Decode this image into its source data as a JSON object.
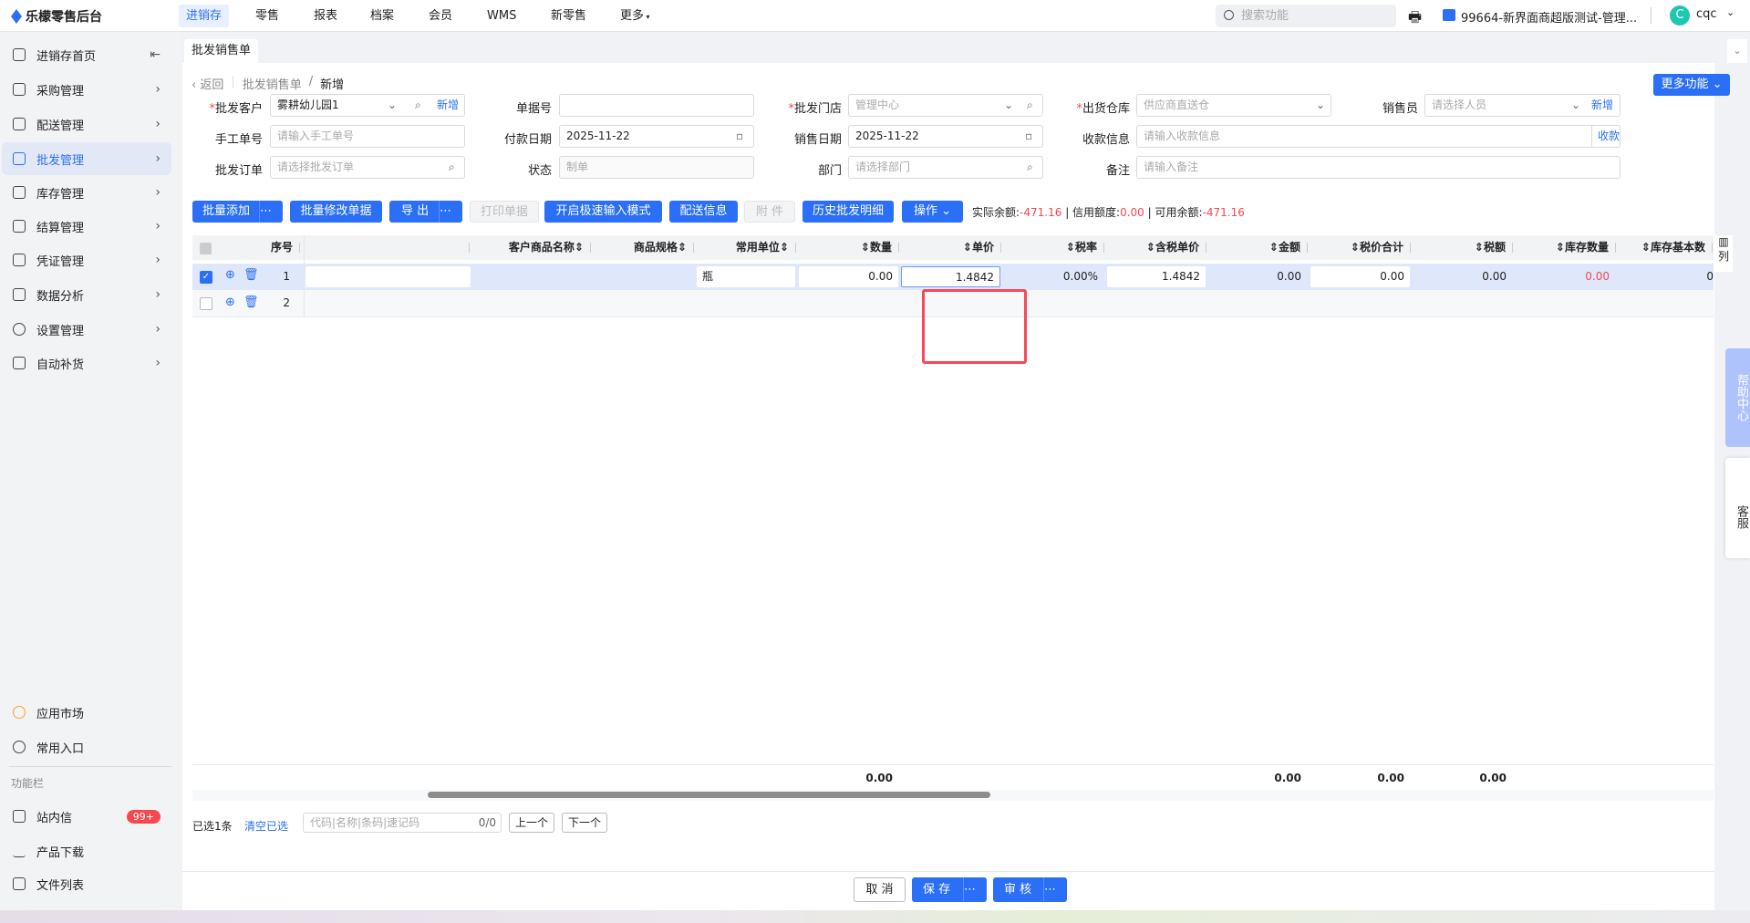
{
  "app": {
    "title": "乐檬零售后台"
  },
  "topnav": [
    "进销存",
    "零售",
    "报表",
    "档案",
    "会员",
    "WMS",
    "新零售",
    "更多"
  ],
  "search": {
    "placeholder": "搜索功能"
  },
  "org": "99664-新界面商超版测试-管理...",
  "user": {
    "avatar": "C",
    "name": "cqc"
  },
  "sidebar": {
    "items": [
      "进销存首页",
      "采购管理",
      "配送管理",
      "批发管理",
      "库存管理",
      "结算管理",
      "凭证管理",
      "数据分析",
      "设置管理",
      "自动补货"
    ],
    "bottom": [
      "应用市场",
      "常用入口"
    ],
    "section": "功能栏",
    "tools": [
      "站内信",
      "产品下载",
      "文件列表"
    ],
    "badge": "99+"
  },
  "tab": "批发销售单",
  "breadcrumb": {
    "back": "返回",
    "parent": "批发销售单",
    "current": "新增"
  },
  "more_button": "更多功能",
  "form": {
    "customer_label": "批发客户",
    "customer_value": "雾耕幼儿园1",
    "add": "新增",
    "doc_no_label": "单据号",
    "store_label": "批发门店",
    "store_value": "管理中心",
    "warehouse_label": "出货仓库",
    "warehouse_value": "供应商直送仓",
    "sales_label": "销售员",
    "sales_placeholder": "请选择人员",
    "manual_label": "手工单号",
    "manual_placeholder": "请输入手工单号",
    "paydate_label": "付款日期",
    "paydate_value": "2025-11-22",
    "saledate_label": "销售日期",
    "saledate_value": "2025-11-22",
    "receipt_label": "收款信息",
    "receipt_placeholder": "请输入收款信息",
    "receipt_link": "收款",
    "order_label": "批发订单",
    "order_placeholder": "请选择批发订单",
    "status_label": "状态",
    "status_value": "制单",
    "dept_label": "部门",
    "dept_placeholder": "请选择部门",
    "remark_label": "备注",
    "remark_placeholder": "请输入备注"
  },
  "toolbar": {
    "batch_add": "批量添加",
    "batch_edit": "批量修改单据",
    "export": "导 出",
    "print": "打印单据",
    "fast_mode": "开启极速输入模式",
    "delivery": "配送信息",
    "attach": "附 件",
    "history": "历史批发明细",
    "ops": "操作",
    "balance_label": "实际余额:",
    "balance": "-471.16",
    "credit_label": "信用额度:",
    "credit": "0.00",
    "avail_label": "可用余额:",
    "avail": "-471.16"
  },
  "table": {
    "columns": [
      "序号",
      "",
      "客户商品名称",
      "商品规格",
      "常用单位",
      "数量",
      "单价",
      "税率",
      "含税单价",
      "金额",
      "税价合计",
      "税额",
      "库存数量",
      "库存基本数"
    ],
    "column_setting": "列",
    "rows": [
      {
        "no": "1",
        "unit": "瓶",
        "qty": "0.00",
        "price": "1.4842",
        "tax_rate": "0.00%",
        "tax_price": "1.4842",
        "amount": "0.00",
        "total": "0.00",
        "tax": "0.00",
        "stock": "0.00",
        "base": "0",
        "checked": true
      },
      {
        "no": "2",
        "checked": false
      }
    ],
    "footer": {
      "qty": "0.00",
      "amount": "0.00",
      "total": "0.00",
      "tax": "0.00"
    }
  },
  "selection": {
    "selected": "已选1条",
    "clear": "清空已选",
    "search_placeholder": "代码|名称|条码|速记码",
    "count": "0/0",
    "prev": "上一个",
    "next": "下一个"
  },
  "actions": {
    "cancel": "取 消",
    "save": "保 存",
    "audit": "审 核"
  },
  "float": {
    "help": "帮助中心",
    "service": "客服"
  },
  "colors": {
    "primary": "#2a6ff5",
    "negative": "#f5484f"
  }
}
